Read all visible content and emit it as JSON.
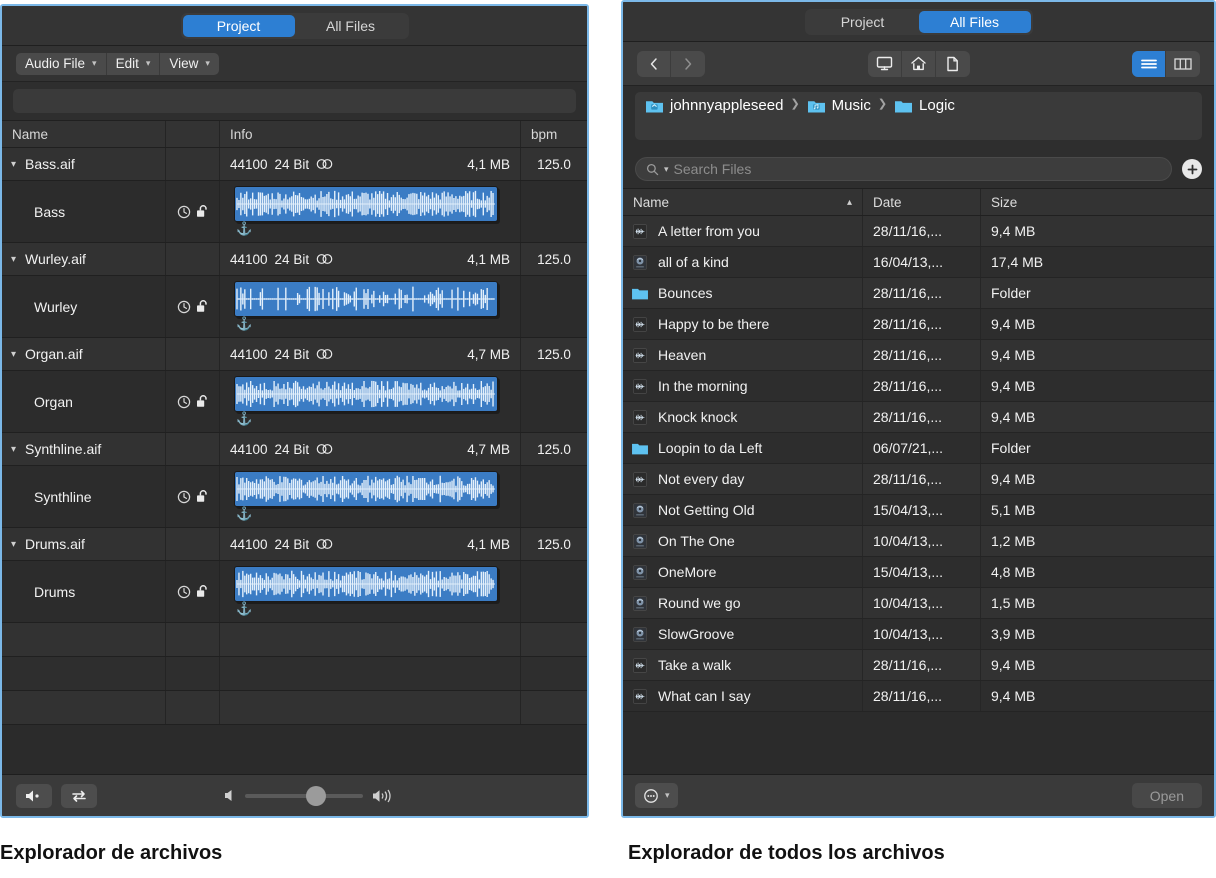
{
  "left_panel": {
    "tabs": [
      {
        "label": "Project",
        "active": true
      },
      {
        "label": "All Files",
        "active": false
      }
    ],
    "menus": [
      {
        "label": "Audio File"
      },
      {
        "label": "Edit"
      },
      {
        "label": "View"
      }
    ],
    "columns": {
      "name": "Name",
      "mid": "",
      "info": "Info",
      "bpm": "bpm"
    },
    "files": [
      {
        "filename": "Bass.aif",
        "sample_rate": "44100",
        "bit_depth": "24 Bit",
        "channels_icon": "stereo-icon",
        "size": "4,1 MB",
        "bpm": "125.0",
        "region": {
          "name": "Bass",
          "icons": [
            "clock-icon",
            "unlocked-icon"
          ]
        }
      },
      {
        "filename": "Wurley.aif",
        "sample_rate": "44100",
        "bit_depth": "24 Bit",
        "channels_icon": "stereo-icon",
        "size": "4,1 MB",
        "bpm": "125.0",
        "region": {
          "name": "Wurley",
          "icons": [
            "clock-icon",
            "unlocked-icon"
          ]
        }
      },
      {
        "filename": "Organ.aif",
        "sample_rate": "44100",
        "bit_depth": "24 Bit",
        "channels_icon": "stereo-icon",
        "size": "4,7 MB",
        "bpm": "125.0",
        "region": {
          "name": "Organ",
          "icons": [
            "clock-icon",
            "unlocked-icon"
          ]
        }
      },
      {
        "filename": "Synthline.aif",
        "sample_rate": "44100",
        "bit_depth": "24 Bit",
        "channels_icon": "stereo-icon",
        "size": "4,7 MB",
        "bpm": "125.0",
        "region": {
          "name": "Synthline",
          "icons": [
            "clock-icon",
            "unlocked-icon"
          ]
        }
      },
      {
        "filename": "Drums.aif",
        "sample_rate": "44100",
        "bit_depth": "24 Bit",
        "channels_icon": "stereo-icon",
        "size": "4,1 MB",
        "bpm": "125.0",
        "region": {
          "name": "Drums",
          "icons": [
            "clock-icon",
            "unlocked-icon"
          ]
        }
      }
    ],
    "empty_rows": 3,
    "footer": {
      "prelisten_icon": "speaker-icon",
      "loop_icon": "loop-icon",
      "volume_low_icon": "speaker-low-icon",
      "volume_high_icon": "speaker-high-icon",
      "volume_value": 52
    }
  },
  "right_panel": {
    "tabs": [
      {
        "label": "Project",
        "active": false
      },
      {
        "label": "All Files",
        "active": true
      }
    ],
    "nav": {
      "back_icon": "chevron-left-icon",
      "forward_icon": "chevron-right-icon",
      "computer_icon": "display-icon",
      "home_icon": "home-icon",
      "document_icon": "document-icon",
      "list_view_icon": "list-view-icon",
      "column_view_icon": "column-view-icon",
      "active_view": "list"
    },
    "breadcrumb": [
      {
        "label": "johnnyappleseed",
        "icon": "home-folder-icon"
      },
      {
        "label": "Music",
        "icon": "music-folder-icon"
      },
      {
        "label": "Logic",
        "icon": "folder-icon"
      }
    ],
    "search": {
      "placeholder": "Search Files",
      "value": "",
      "search_icon": "search-icon",
      "add_icon": "plus-icon"
    },
    "columns": {
      "name": "Name",
      "date": "Date",
      "size": "Size",
      "sort_column": "Name",
      "sort_direction": "ascending"
    },
    "rows": [
      {
        "name": "A letter from you",
        "date": "28/11/16,...",
        "size": "9,4 MB",
        "icon": "audio-file-icon"
      },
      {
        "name": "all of a kind",
        "date": "16/04/13,...",
        "size": "17,4 MB",
        "icon": "project-file-icon"
      },
      {
        "name": "Bounces",
        "date": "28/11/16,...",
        "size": "Folder",
        "icon": "folder-icon"
      },
      {
        "name": "Happy to be there",
        "date": "28/11/16,...",
        "size": "9,4 MB",
        "icon": "audio-file-icon"
      },
      {
        "name": "Heaven",
        "date": "28/11/16,...",
        "size": "9,4 MB",
        "icon": "audio-file-icon"
      },
      {
        "name": "In the morning",
        "date": "28/11/16,...",
        "size": "9,4 MB",
        "icon": "audio-file-icon"
      },
      {
        "name": "Knock knock",
        "date": "28/11/16,...",
        "size": "9,4 MB",
        "icon": "audio-file-icon"
      },
      {
        "name": "Loopin to da Left",
        "date": "06/07/21,...",
        "size": "Folder",
        "icon": "folder-icon"
      },
      {
        "name": "Not every day",
        "date": "28/11/16,...",
        "size": "9,4 MB",
        "icon": "audio-file-icon"
      },
      {
        "name": "Not Getting Old",
        "date": "15/04/13,...",
        "size": "5,1 MB",
        "icon": "project-file-icon"
      },
      {
        "name": "On The One",
        "date": "10/04/13,...",
        "size": "1,2 MB",
        "icon": "project-file-icon"
      },
      {
        "name": "OneMore",
        "date": "15/04/13,...",
        "size": "4,8 MB",
        "icon": "project-file-icon"
      },
      {
        "name": "Round we go",
        "date": "10/04/13,...",
        "size": "1,5 MB",
        "icon": "project-file-icon"
      },
      {
        "name": "SlowGroove",
        "date": "10/04/13,...",
        "size": "3,9 MB",
        "icon": "project-file-icon"
      },
      {
        "name": "Take a walk",
        "date": "28/11/16,...",
        "size": "9,4 MB",
        "icon": "audio-file-icon"
      },
      {
        "name": "What can I say",
        "date": "28/11/16,...",
        "size": "9,4 MB",
        "icon": "audio-file-icon"
      }
    ],
    "footer": {
      "action_icon": "more-actions-icon",
      "action_chevron": "chevron-down-icon",
      "open_label": "Open"
    }
  },
  "captions": {
    "left": "Explorador de archivos",
    "right": "Explorador de todos los archivos"
  },
  "colors": {
    "accent": "#2d7fd3",
    "region": "#3b7cc4",
    "panel_border": "#7bb8e8",
    "folder": "#5ec2f0"
  }
}
